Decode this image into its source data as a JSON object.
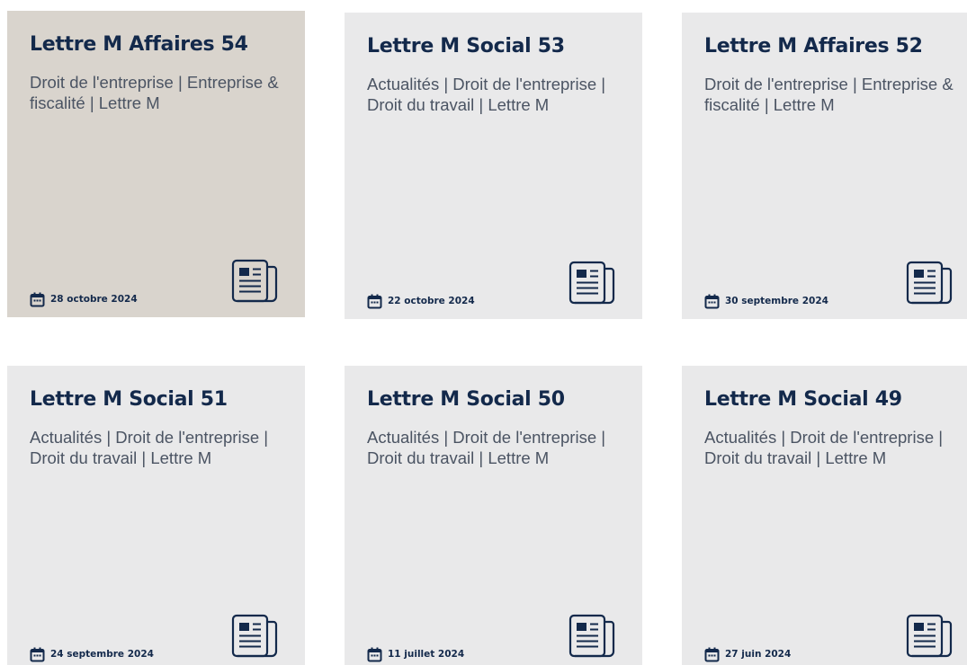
{
  "colors": {
    "card_bg": "#e9e9ea",
    "card_bg_active": "#d9d4cd",
    "title": "#13294b",
    "tags": "#4b5463",
    "icon": "#13294b"
  },
  "icons": {
    "date": "calendar-icon",
    "card": "newspaper-icon"
  },
  "cards": [
    {
      "title": "Lettre M Affaires 54",
      "tags": "Droit de l'entreprise | Entreprise & fiscalité | Lettre M",
      "date": "28 octobre 2024",
      "active": true
    },
    {
      "title": "Lettre M Social 53",
      "tags": "Actualités | Droit de l'entreprise | Droit du travail | Lettre M",
      "date": "22 octobre 2024",
      "active": false
    },
    {
      "title": "Lettre M Affaires 52",
      "tags": "Droit de l'entreprise | Entreprise & fiscalité | Lettre M",
      "date": "30 septembre 2024",
      "active": false
    },
    {
      "title": "Lettre M Social 51",
      "tags": "Actualités | Droit de l'entreprise | Droit du travail | Lettre M",
      "date": "24 septembre 2024",
      "active": false
    },
    {
      "title": "Lettre M Social 50",
      "tags": "Actualités | Droit de l'entreprise | Droit du travail | Lettre M",
      "date": "11 juillet 2024",
      "active": false
    },
    {
      "title": "Lettre M Social 49",
      "tags": "Actualités | Droit de l'entreprise | Droit du travail | Lettre M",
      "date": "27 juin 2024",
      "active": false
    }
  ]
}
